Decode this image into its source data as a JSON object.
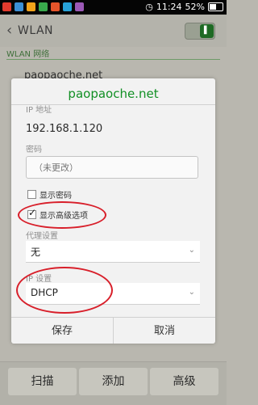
{
  "status": {
    "time": "11:24",
    "battery": "52%"
  },
  "header": {
    "back": "‹",
    "title": "WLAN",
    "toggle_glyph": "▌"
  },
  "section": {
    "label": "WLAN 网络"
  },
  "network": {
    "name": "paopaoche.net"
  },
  "dialog": {
    "watermark": "paopaoche.net",
    "ip_label": "IP 地址",
    "ip_value": "192.168.1.120",
    "password_label": "密码",
    "password_placeholder": "（未更改）",
    "show_password": "显示密码",
    "show_advanced": "显示高级选项",
    "show_advanced_checked": true,
    "proxy_label": "代理设置",
    "proxy_value": "无",
    "ip_settings_label": "IP 设置",
    "ip_settings_value": "DHCP",
    "save": "保存",
    "cancel": "取消"
  },
  "bottom": {
    "scan": "扫描",
    "add": "添加",
    "advanced": "高级"
  }
}
